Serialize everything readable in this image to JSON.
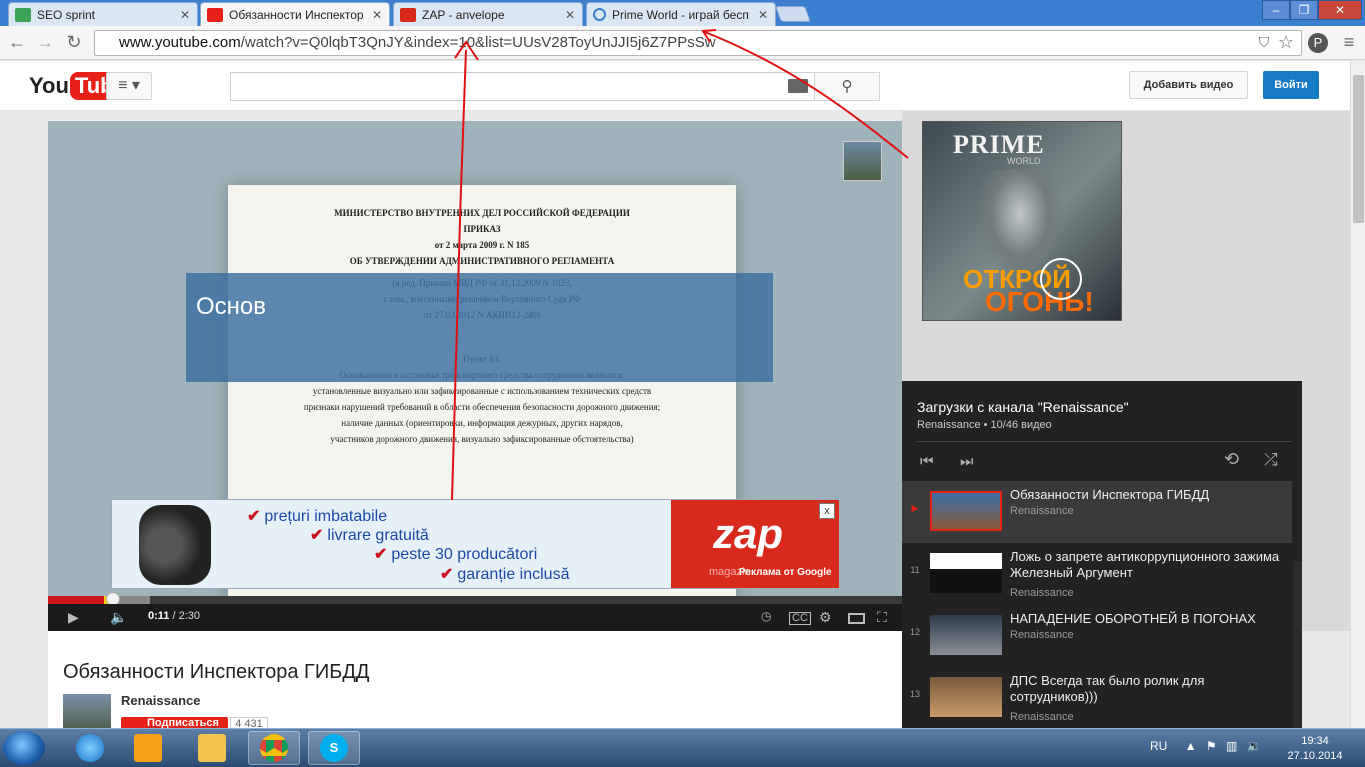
{
  "browser": {
    "tabs": [
      {
        "title": "SEO sprint",
        "active": false
      },
      {
        "title": "Обязанности Инспектор",
        "active": true
      },
      {
        "title": "ZAP - anvelope",
        "active": false
      },
      {
        "title": "Prime World - играй бесп",
        "active": false
      }
    ],
    "url_domain": "www.youtube.com",
    "url_path": "/watch?v=Q0lqbT3QnJY&index=10&list=UUsV28ToyUnJJI5j6Z7PPsSw"
  },
  "yt_header": {
    "logo_you": "You",
    "logo_tube": "Tube",
    "search_placeholder": "",
    "upload_label": "Добавить видео",
    "signin_label": "Войти"
  },
  "player": {
    "doc_lines": [
      "МИНИСТЕРСТВО ВНУТРЕННИХ ДЕЛ РОССИЙСКОЙ ФЕДЕРАЦИИ",
      "ПРИКАЗ",
      "от 2 марта 2009 г. N 185",
      "ОБ УТВЕРЖДЕНИИ АДМИНИСТРАТИВНОГО РЕГЛАМЕНТА",
      "(в ред. Приказа МВД РФ от 31.12.2009 N 1023,",
      "с изм., внесенными решением Верховного Суда РФ",
      "от 27.03.2012 N АКПИ12-249)",
      "Пункт 63.",
      "Основаниями к остановке транспортного средства сотрудником являются:",
      "установленные визуально или зафиксированные с использованием технических средств",
      "признаки нарушений требований в области обеспечения безопасности дорожного движения;",
      "наличие данных (ориентировки, информация дежурных, других нарядов,",
      "участников дорожного движения, визуально зафиксированные обстоятельства)"
    ],
    "annotation_text": "Основ",
    "ad": {
      "lines": [
        "prețuri imbatabile",
        "livrare gratuită",
        "peste 30 producători",
        "garanție inclusă"
      ],
      "brand": "zap",
      "brand_sub": "magazin",
      "google_label": "Реклама от Google",
      "close_label": "x"
    },
    "progress_fraction": 0.073,
    "time_current": "0:11",
    "time_total": "2:30"
  },
  "video": {
    "title": "Обязанности Инспектора ГИБДД",
    "channel": "Renaissance",
    "subscribe_label": "Подписаться",
    "subscriber_count": "4 431"
  },
  "sidebar_ad": {
    "logo": "PRIME",
    "logo_sub": "WORLD",
    "cta1": "ОТКРОЙ",
    "cta2": "ОГОНЬ!"
  },
  "playlist": {
    "title": "Загрузки с канала \"Renaissance\"",
    "subtitle": "Renaissance • 10/46 видео",
    "items": [
      {
        "index": "▶",
        "title": "Обязанности Инспектора ГИБДД",
        "channel": "Renaissance",
        "active": true
      },
      {
        "index": "11",
        "title": "Ложь о запрете антикоррупционного зажима Железный Аргумент",
        "channel": "Renaissance",
        "active": false
      },
      {
        "index": "12",
        "title": "НАПАДЕНИЕ ОБОРОТНЕЙ В ПОГОНАХ",
        "channel": "Renaissance",
        "active": false
      },
      {
        "index": "13",
        "title": "ДПС Всегда так было ролик для сотрудников)))",
        "channel": "Renaissance",
        "active": false
      }
    ]
  },
  "taskbar": {
    "lang": "RU",
    "time": "19:34",
    "date": "27.10.2014"
  },
  "colors": {
    "yt_red": "#e62117",
    "signin_blue": "#167ac6",
    "annotation_arrow": "#e01010"
  }
}
